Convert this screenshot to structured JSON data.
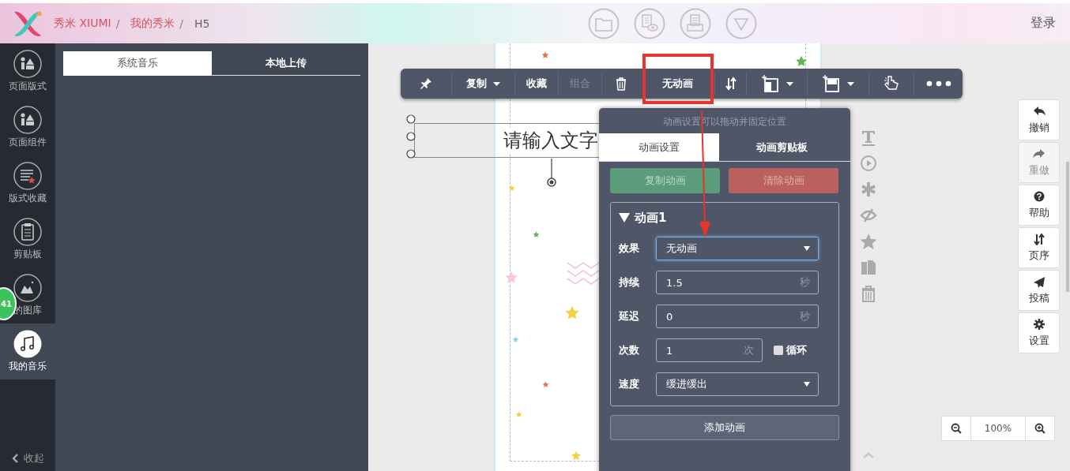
{
  "header": {
    "breadcrumb": [
      {
        "kind": "link",
        "label": "秀米 XIUMI"
      },
      {
        "kind": "separator",
        "label": "/"
      },
      {
        "kind": "link",
        "label": "我的秀米"
      },
      {
        "kind": "separator",
        "label": "/"
      },
      {
        "kind": "current",
        "label": "H5"
      }
    ],
    "login": "登录"
  },
  "sidebar": {
    "items": [
      {
        "label": "页面版式",
        "selected": false
      },
      {
        "label": "页面组件",
        "selected": false
      },
      {
        "label": "版式收藏",
        "selected": false
      },
      {
        "label": "剪贴板",
        "selected": false
      },
      {
        "label": "的图库",
        "selected": false
      },
      {
        "label": "我的音乐",
        "selected": true
      }
    ],
    "badge": "41",
    "collapse": "收起"
  },
  "music_panel": {
    "tabs": [
      {
        "label": "系统音乐",
        "selected": true
      },
      {
        "label": "本地上传",
        "selected": false
      }
    ]
  },
  "toolbar": {
    "items": [
      {
        "kind": "icon",
        "caret": false
      },
      {
        "kind": "button",
        "label": "复制",
        "caret": true,
        "disabled": false
      },
      {
        "kind": "button",
        "label": "收藏",
        "caret": false,
        "disabled": false
      },
      {
        "kind": "button",
        "label": "组合",
        "caret": false,
        "disabled": true
      },
      {
        "kind": "icon",
        "caret": false
      },
      {
        "kind": "button",
        "label": "无动画",
        "caret": false,
        "disabled": false
      },
      {
        "kind": "icon",
        "caret": false
      },
      {
        "kind": "icon",
        "caret": true
      },
      {
        "kind": "icon",
        "caret": true
      },
      {
        "kind": "icon",
        "caret": false
      },
      {
        "kind": "icon",
        "caret": false
      }
    ]
  },
  "canvas": {
    "text_box": "请输入文字"
  },
  "animation_panel": {
    "hint": "动画设置可以拖动并固定位置",
    "tabs": [
      {
        "label": "动画设置",
        "selected": true
      },
      {
        "label": "动画剪贴板",
        "selected": false
      }
    ],
    "actions": [
      {
        "kind": "copy",
        "label": "复制动画"
      },
      {
        "kind": "clear",
        "label": "清除动画"
      }
    ],
    "animations": [
      {
        "title": "动画1",
        "expanded": true,
        "fields": [
          {
            "kind": "select",
            "label": "效果",
            "value": "无动画",
            "focused": true
          },
          {
            "kind": "number",
            "label": "持续",
            "value": "1.5",
            "unit": "秒",
            "focused": false
          },
          {
            "kind": "number",
            "label": "延迟",
            "value": "0",
            "unit": "秒",
            "focused": false
          },
          {
            "kind": "count",
            "label": "次数",
            "value": "1",
            "unit": "次",
            "focused": false,
            "checkbox": {
              "label": "循环",
              "checked": false
            }
          },
          {
            "kind": "select",
            "label": "速度",
            "value": "缓进缓出",
            "focused": false
          }
        ]
      }
    ],
    "add_button": "添加动画"
  },
  "right_tools": [
    {
      "label": "撤销",
      "disabled": false
    },
    {
      "label": "重做",
      "disabled": true
    },
    {
      "label": "帮助",
      "disabled": false
    },
    {
      "label": "页序",
      "disabled": false
    },
    {
      "label": "投稿",
      "disabled": false
    },
    {
      "label": "设置",
      "disabled": false
    }
  ],
  "zoom": {
    "value": "100%"
  }
}
